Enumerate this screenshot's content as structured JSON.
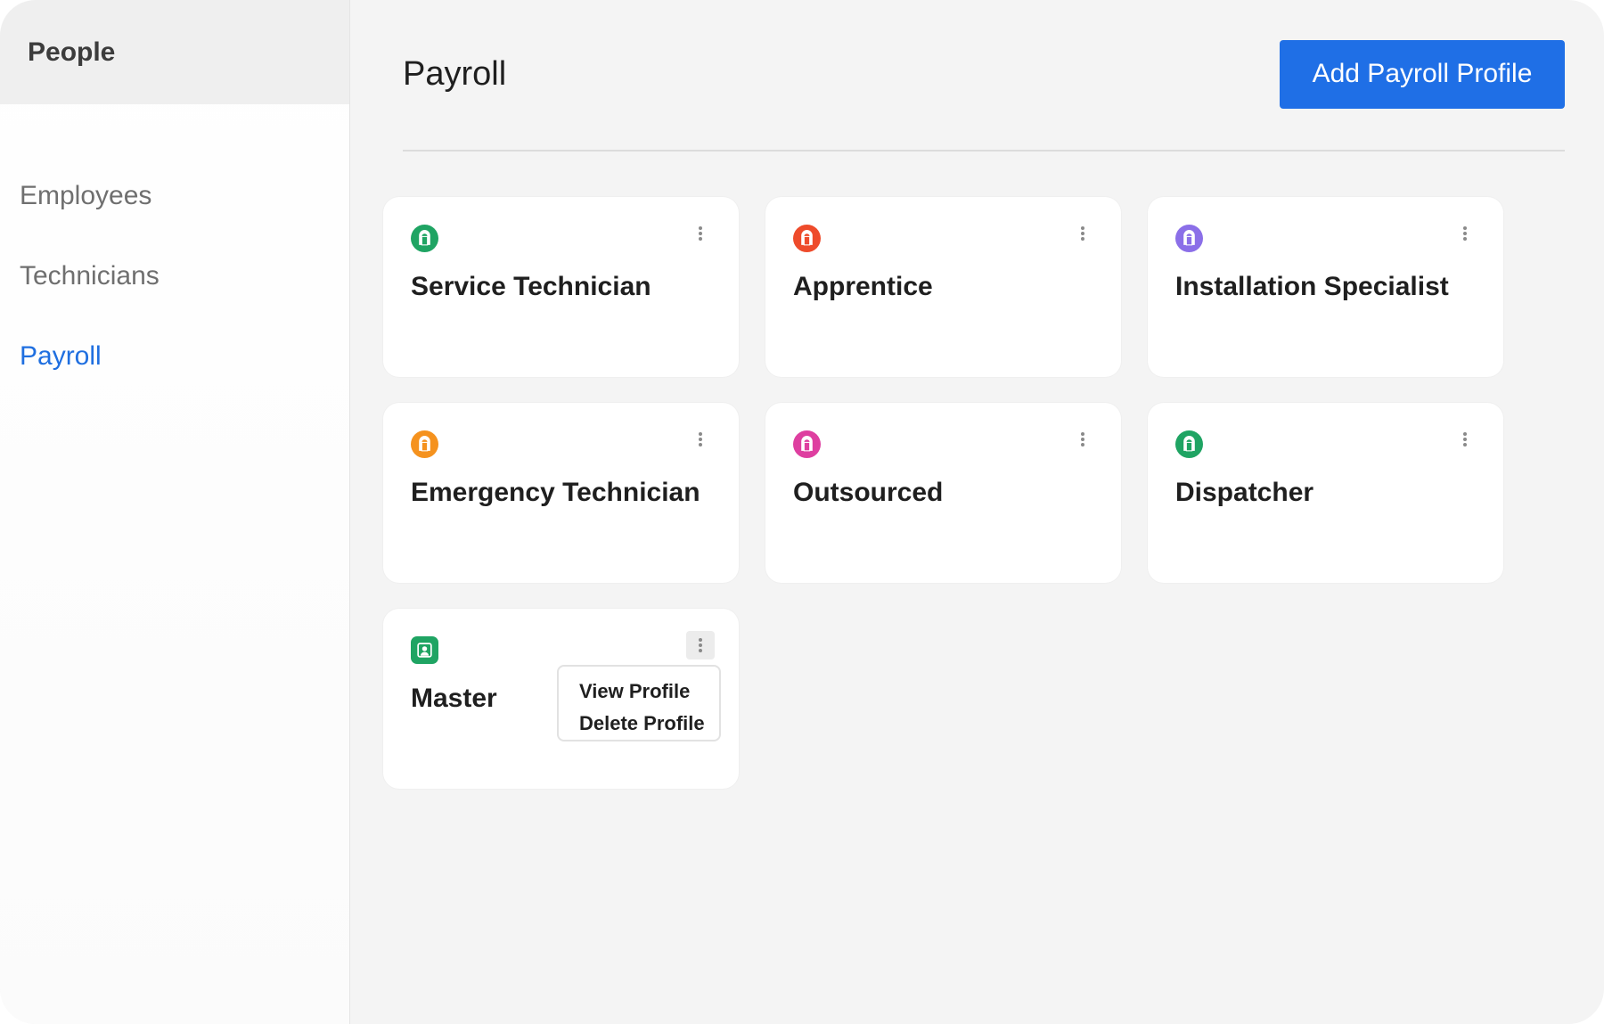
{
  "sidebar": {
    "title": "People",
    "items": [
      {
        "label": "Employees",
        "active": false
      },
      {
        "label": "Technicians",
        "active": false
      },
      {
        "label": "Payroll",
        "active": true
      }
    ]
  },
  "header": {
    "title": "Payroll",
    "add_button_label": "Add Payroll Profile"
  },
  "colors": {
    "accent": "#1f6fe6",
    "active_nav": "#1f6fe0"
  },
  "cards": [
    {
      "title": "Service Technician",
      "icon": "profile-icon",
      "icon_color": "#1fa463"
    },
    {
      "title": "Apprentice",
      "icon": "profile-icon",
      "icon_color": "#ee4b2b"
    },
    {
      "title": "Installation Specialist",
      "icon": "profile-icon",
      "icon_color": "#8b6fe8"
    },
    {
      "title": "Emergency Technician",
      "icon": "profile-icon",
      "icon_color": "#f5921e"
    },
    {
      "title": "Outsourced",
      "icon": "profile-icon",
      "icon_color": "#de3fa0"
    },
    {
      "title": "Dispatcher",
      "icon": "profile-icon",
      "icon_color": "#1fa463"
    },
    {
      "title": "Master",
      "icon": "user-profile-icon",
      "icon_color": "#1fa463"
    }
  ],
  "menu": {
    "view_label": "View Profile",
    "delete_label": "Delete Profile"
  }
}
